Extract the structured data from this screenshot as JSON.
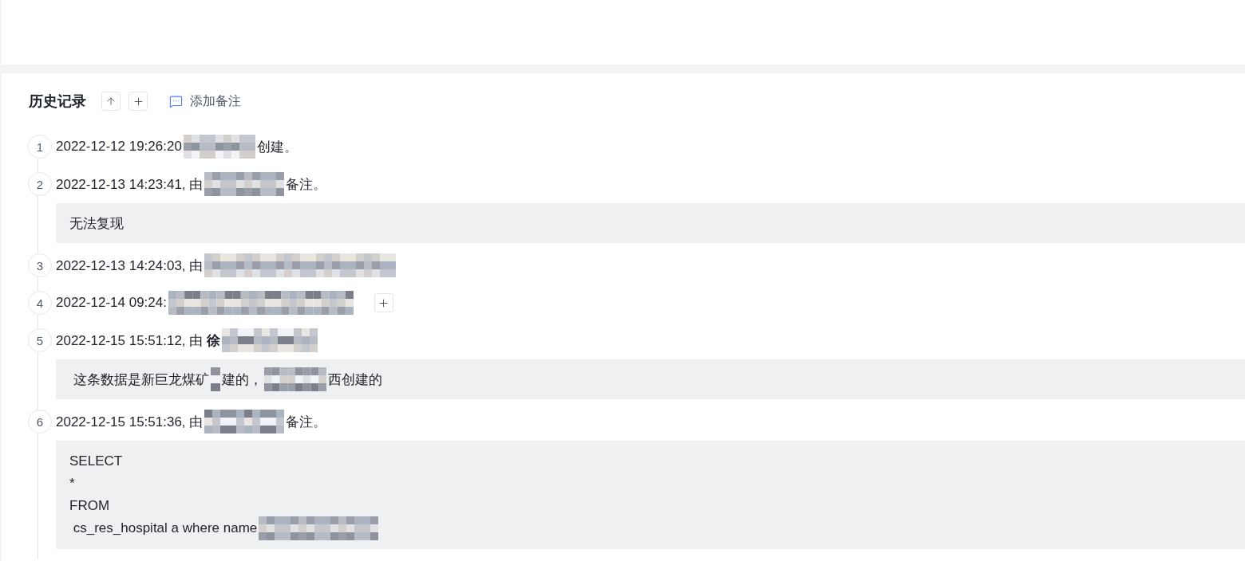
{
  "history": {
    "title": "历史记录",
    "toolbar": [
      {
        "kind": "move_up"
      },
      {
        "kind": "add"
      }
    ],
    "add_note_label": "添加备注",
    "entries": [
      {
        "number": "1",
        "parts": [
          {
            "kind": "text",
            "text": "2022-12-12 19:26:20"
          },
          {
            "kind": "redacted"
          },
          {
            "kind": "text",
            "text": "创建。"
          }
        ]
      },
      {
        "number": "2",
        "parts": [
          {
            "kind": "text",
            "text": "2022-12-13 14:23:41, 由"
          },
          {
            "kind": "redacted"
          },
          {
            "kind": "text",
            "text": "备注。"
          }
        ],
        "note": {
          "kind": "text",
          "lines": [
            [
              {
                "kind": "text",
                "text": "无法复现"
              }
            ]
          ]
        }
      },
      {
        "number": "3",
        "parts": [
          {
            "kind": "text",
            "text": "2022-12-13 14:24:03, 由"
          },
          {
            "kind": "redacted"
          }
        ]
      },
      {
        "number": "4",
        "parts": [
          {
            "kind": "text",
            "text": "2022-12-14 09:24:"
          },
          {
            "kind": "redacted"
          },
          {
            "kind": "add_button"
          }
        ]
      },
      {
        "number": "5",
        "parts": [
          {
            "kind": "text",
            "text": "2022-12-15 15:51:12, 由 **徐**"
          },
          {
            "kind": "redacted"
          }
        ],
        "note": {
          "kind": "text",
          "lines": [
            [
              {
                "kind": "text",
                "text": " 这条数据是新巨龙煤矿"
              },
              {
                "kind": "redacted"
              },
              {
                "kind": "text",
                "text": "建的，"
              },
              {
                "kind": "redacted"
              },
              {
                "kind": "text",
                "text": "西创建的"
              }
            ]
          ]
        }
      },
      {
        "number": "6",
        "parts": [
          {
            "kind": "text",
            "text": "2022-12-15 15:51:36, 由"
          },
          {
            "kind": "redacted"
          },
          {
            "kind": "text",
            "text": "备注。"
          }
        ],
        "note": {
          "kind": "code",
          "lines": [
            [
              {
                "kind": "text",
                "text": "SELECT"
              }
            ],
            [
              {
                "kind": "text",
                "text": "*"
              }
            ],
            [
              {
                "kind": "text",
                "text": "FROM"
              }
            ],
            [
              {
                "kind": "text",
                "text": " cs_res_hospital a where name"
              },
              {
                "kind": "redacted"
              }
            ]
          ]
        }
      }
    ]
  }
}
